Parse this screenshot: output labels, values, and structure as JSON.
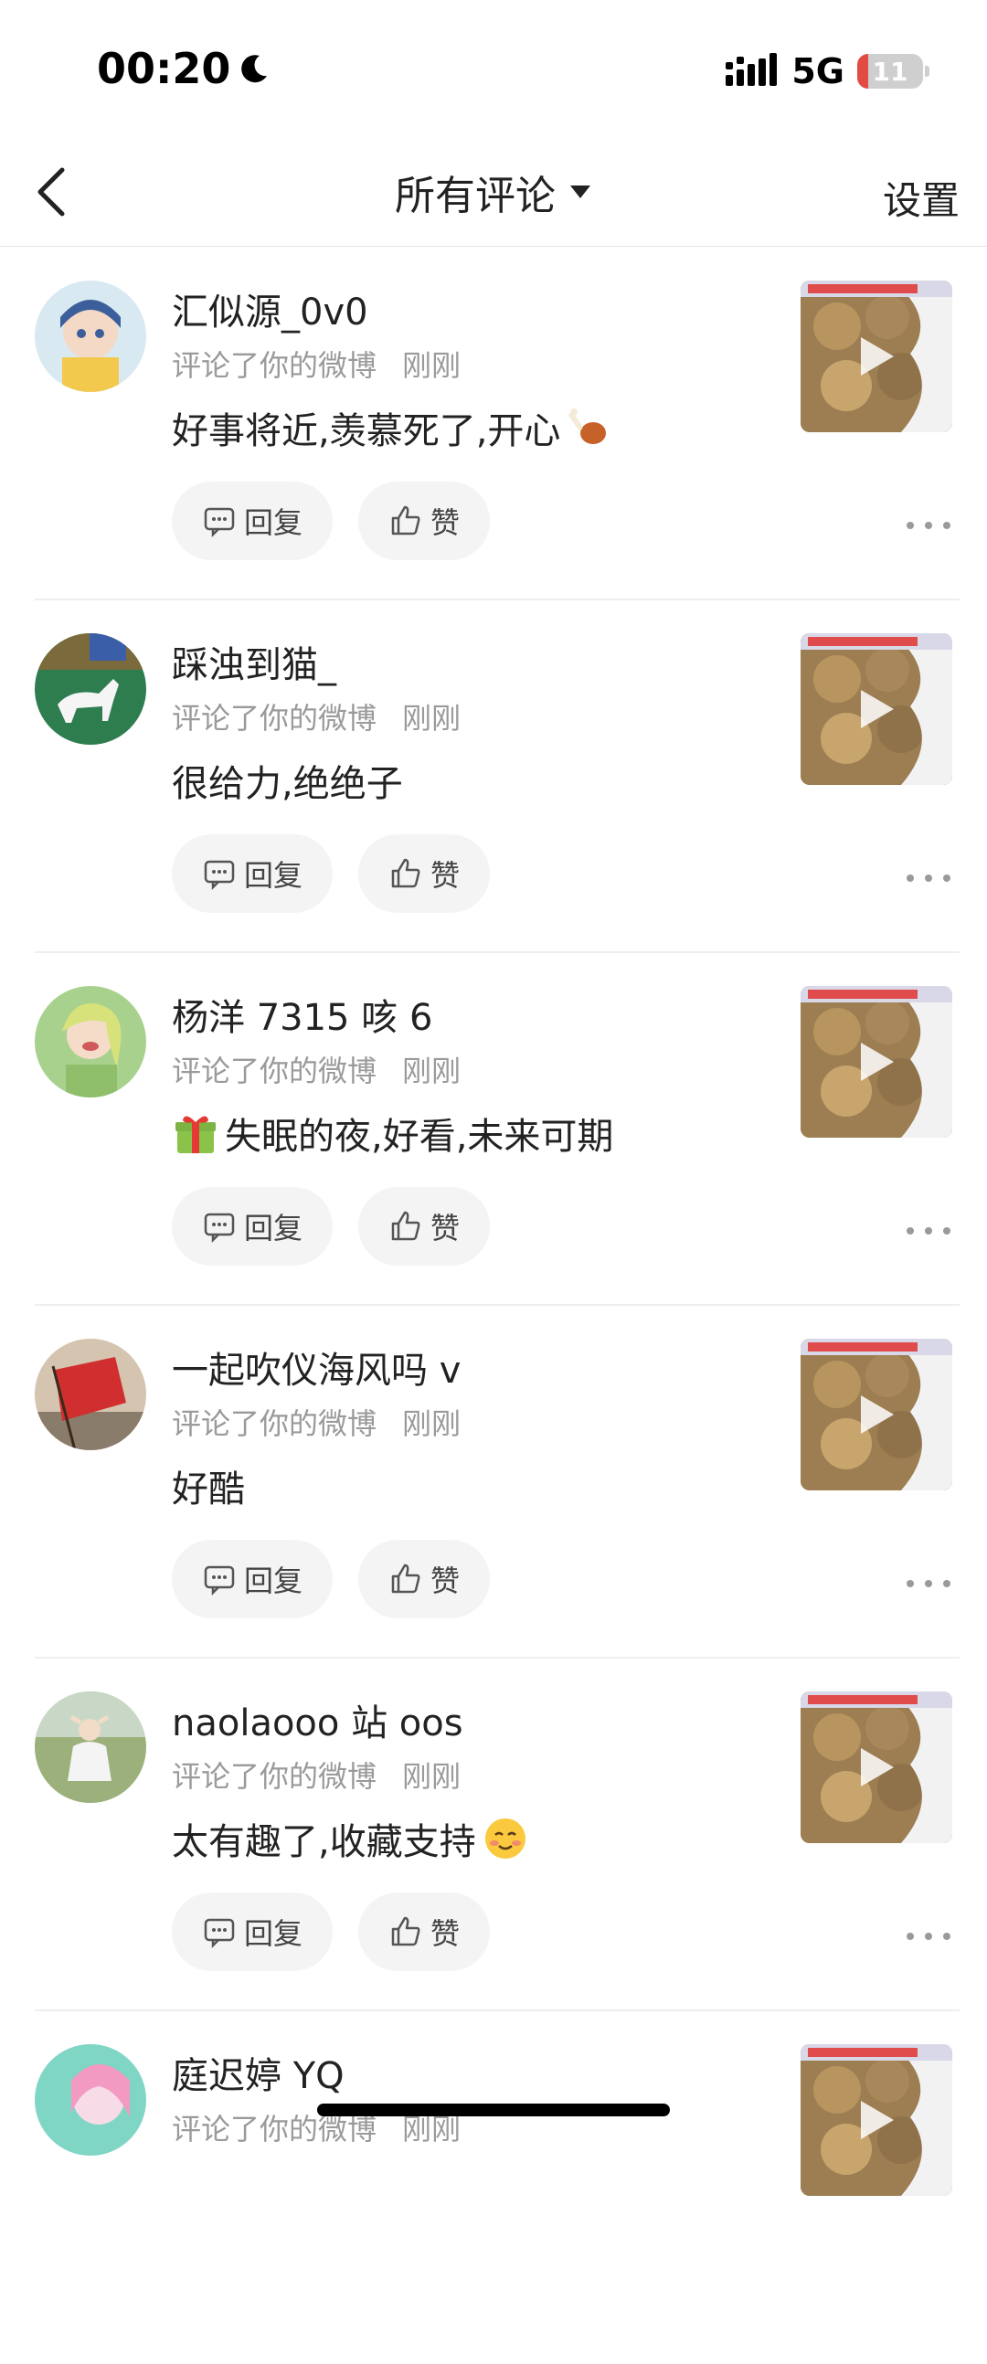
{
  "status_bar": {
    "time": "00:20",
    "network": "5G",
    "battery": "11"
  },
  "header": {
    "title": "所有评论",
    "settings_label": "设置"
  },
  "actions": {
    "reply_label": "回复",
    "like_label": "赞"
  },
  "comments": [
    {
      "username": "汇似源_0v0",
      "action_text": "评论了你的微博",
      "time": "刚刚",
      "text": "好事将近,羡慕死了,开心",
      "emoji": "poultry-leg-emoji"
    },
    {
      "username": "踩浊到猫_",
      "action_text": "评论了你的微博",
      "time": "刚刚",
      "text": "很给力,绝绝子"
    },
    {
      "username": "杨洋 7315 咳 6",
      "action_text": "评论了你的微博",
      "time": "刚刚",
      "text": "失眠的夜,好看,未来可期",
      "emoji": "gift-emoji"
    },
    {
      "username": "一起吹仪海风吗 v",
      "action_text": "评论了你的微博",
      "time": "刚刚",
      "text": "好酷"
    },
    {
      "username": "naolaooo 站 oos",
      "action_text": "评论了你的微博",
      "time": "刚刚",
      "text": "太有趣了,收藏支持",
      "emoji": "blushing-smile-emoji"
    },
    {
      "username": "庭迟婷 YQ",
      "action_text": "评论了你的微博",
      "time": "刚刚",
      "text": ""
    }
  ],
  "colors": {
    "text_primary": "#222222",
    "text_secondary": "#9a9a9a",
    "button_bg": "#f4f4f4",
    "divider": "#eeeeee",
    "battery_low": "#e24a44"
  },
  "icons": [
    "moon-icon",
    "signal-icon",
    "battery-icon",
    "back-icon",
    "caret-down-icon",
    "comment-icon",
    "thumbs-up-icon",
    "more-icon",
    "play-icon"
  ]
}
